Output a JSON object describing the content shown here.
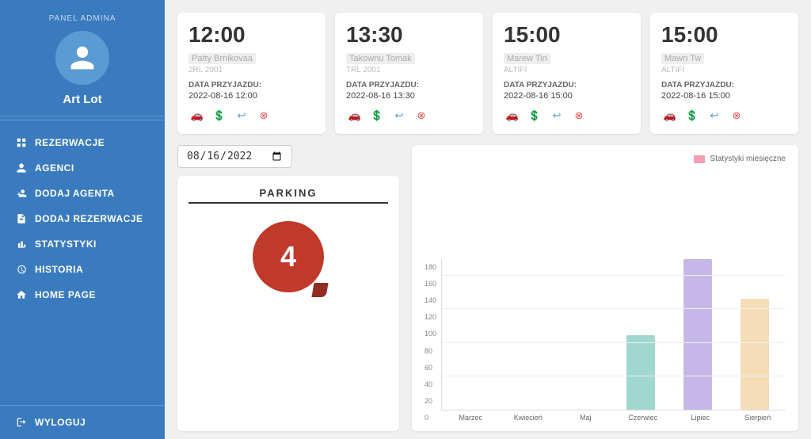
{
  "sidebar": {
    "panel_label": "PANEL ADMINA",
    "username": "Art Lot",
    "nav_items": [
      {
        "id": "rezerwacje",
        "label": "REZERWACJE",
        "icon": "grid"
      },
      {
        "id": "agenci",
        "label": "AGENCI",
        "icon": "person"
      },
      {
        "id": "dodaj-agenta",
        "label": "DODAJ AGENTA",
        "icon": "person-add"
      },
      {
        "id": "dodaj-rezerwacje",
        "label": "DODAJ REZERWACJE",
        "icon": "file-add"
      },
      {
        "id": "statystyki",
        "label": "STATYSTYKI",
        "icon": "chart"
      },
      {
        "id": "historia",
        "label": "HISTORIA",
        "icon": "clock"
      },
      {
        "id": "home-page",
        "label": "HOME PAGE",
        "icon": "home"
      }
    ],
    "logout_label": "WYLOGUJ"
  },
  "cards": [
    {
      "time": "12:00",
      "name": "Patty Brnikovaa",
      "id": "2RL 2001",
      "date_label": "DATA PRZYJAZDU:",
      "date_value": "2022-08-16  12:00"
    },
    {
      "time": "13:30",
      "name": "Takownu Tomak",
      "id": "TRL 2001",
      "date_label": "DATA PRZYJAZDU:",
      "date_value": "2022-08-16  13:30"
    },
    {
      "time": "15:00",
      "name": "Marew Tin",
      "id": "ALTIFI",
      "date_label": "DATA PRZYJAZDU:",
      "date_value": "2022-08-16  15:00"
    },
    {
      "time": "15:00",
      "name": "Mawn Tw",
      "id": "ALTIFI",
      "date_label": "DATA PRZYJAZDU:",
      "date_value": "2022-08-16  15:00"
    }
  ],
  "bottom": {
    "date_value": "2022-08-16",
    "parking_title": "PARKING",
    "parking_number": "4"
  },
  "chart": {
    "legend_label": "Statystyki miesięczne",
    "y_labels": [
      "0",
      "20",
      "40",
      "60",
      "80",
      "100",
      "120",
      "140",
      "160",
      "180"
    ],
    "bars": [
      {
        "label": "Marzec",
        "height_pct": 0,
        "color": "#e8e8e8"
      },
      {
        "label": "Kwiecień",
        "height_pct": 0,
        "color": "#e8e8e8"
      },
      {
        "label": "Maj",
        "height_pct": 0,
        "color": "#e8e8e8"
      },
      {
        "label": "Czerwiec",
        "height_pct": 47,
        "color": "#a0d8cf"
      },
      {
        "label": "Lipiec",
        "height_pct": 95,
        "color": "#c5b8e8"
      },
      {
        "label": "Sierpień",
        "height_pct": 70,
        "color": "#f5ddb8"
      }
    ],
    "max_value": 180
  }
}
